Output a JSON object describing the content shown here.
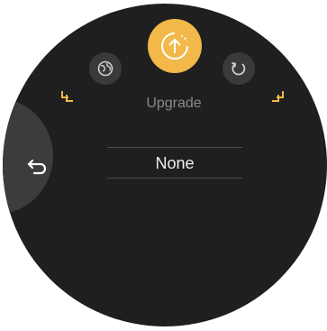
{
  "mode": {
    "label": "Upgrade"
  },
  "picker": {
    "value": "None"
  },
  "icons": {
    "center": "upgrade-icon",
    "left": "globe-icon",
    "right": "refresh-icon",
    "back": "back-arrow-icon"
  },
  "colors": {
    "accent": "#f2b94a",
    "face": "#1f1f1f"
  }
}
